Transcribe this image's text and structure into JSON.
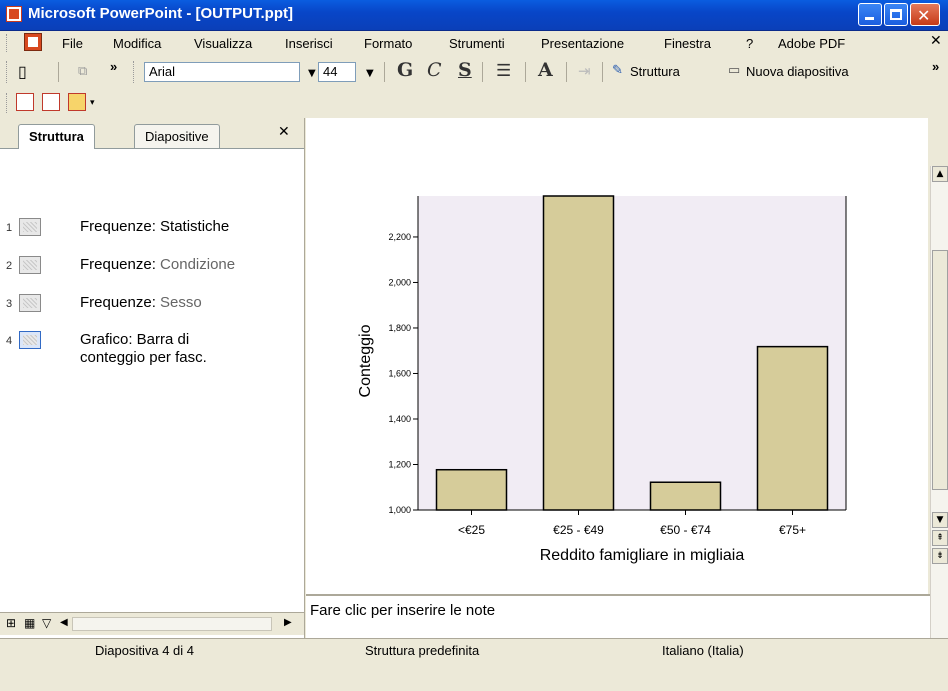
{
  "window": {
    "title": "Microsoft PowerPoint - [OUTPUT.ppt]"
  },
  "menu": [
    "File",
    "Modifica",
    "Visualizza",
    "Inserisci",
    "Formato",
    "Strumenti",
    "Presentazione",
    "Finestra",
    "?",
    "Adobe PDF"
  ],
  "toolbar": {
    "font_name": "Arial",
    "font_size": "44",
    "bold": "G",
    "italic": "C",
    "underline": "S",
    "design_label": "Struttura",
    "new_slide_label": "Nuova diapositiva"
  },
  "left_pane": {
    "tabs": [
      "Struttura",
      "Diapositive"
    ],
    "items": [
      {
        "num": "1",
        "line1": "Frequenze: Statistiche",
        "line1b": "",
        "line2": ""
      },
      {
        "num": "2",
        "line1": "Frequenze: ",
        "line1b": "Condizione",
        "line2": ""
      },
      {
        "num": "3",
        "line1": "Frequenze: ",
        "line1b": "Sesso",
        "line2": ""
      },
      {
        "num": "4",
        "line1": "Grafico: Barra di",
        "line1b": "",
        "line2": "conteggio per fasc."
      }
    ]
  },
  "notes": {
    "placeholder": "Fare clic per inserire le note"
  },
  "status": {
    "slide": "Diapositiva 4 di 4",
    "design": "Struttura predefinita",
    "language": "Italiano (Italia)"
  },
  "colors": {
    "bar_fill": "#d6cc9a",
    "plot_bg": "#f1ecf4",
    "title_bar": "#0846c8"
  },
  "chart_data": {
    "type": "bar",
    "categories": [
      "<€25",
      "€25 - €49",
      "€50 - €74",
      "€75+"
    ],
    "values": [
      1177,
      2380,
      1122,
      1718
    ],
    "xlabel": "Reddito famigliare in migliaia",
    "ylabel": "Conteggio",
    "yticks": [
      "1,000",
      "1,200",
      "1,400",
      "1,600",
      "1,800",
      "2,000",
      "2,200"
    ],
    "ylim": [
      1000,
      2380
    ],
    "grid": false
  }
}
